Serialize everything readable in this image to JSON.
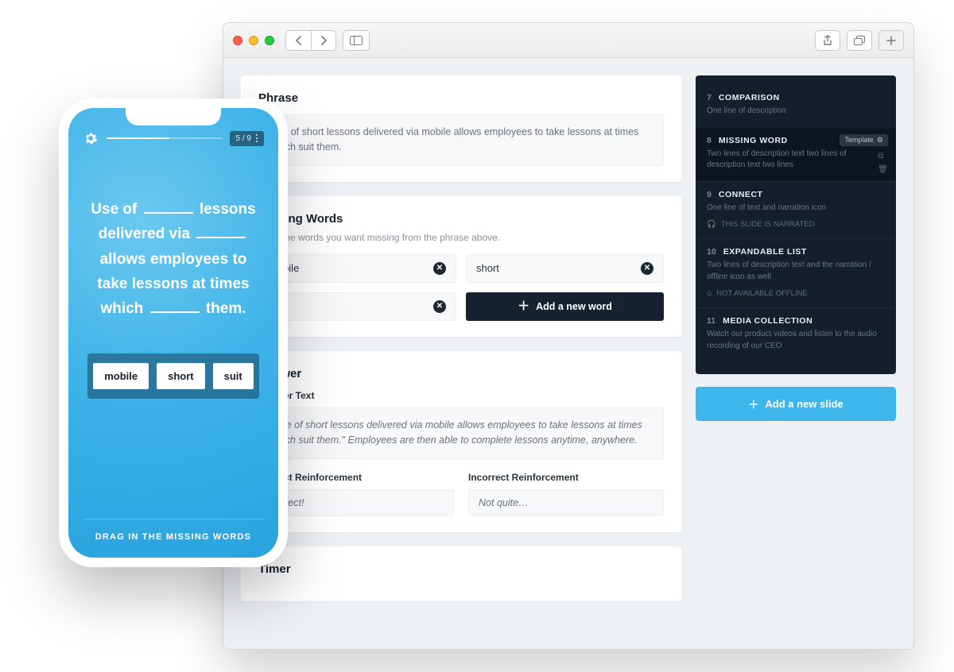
{
  "browser": {
    "buttons": {
      "back": "‹",
      "forward": "›",
      "sidebar": "▥",
      "share": "⇧",
      "tabs": "▣",
      "newtab": "+"
    }
  },
  "editor": {
    "phrase": {
      "title": "Phrase",
      "text": "Use of short lessons delivered via mobile allows employees to take lessons at times which suit them."
    },
    "missing": {
      "title": "Missing Words",
      "hint": "Input the words you want missing from the phrase above.",
      "words": [
        "mobile",
        "short",
        "suit"
      ],
      "add_label": "Add a new word"
    },
    "answer": {
      "title": "Answer",
      "text_label": "Answer Text",
      "text": "\"Use of short lessons delivered via mobile allows employees to take lessons at times which suit them.\" Employees are then able to complete lessons anytime, anywhere.",
      "correct_label": "Correct Reinforcement",
      "correct": "Correct!",
      "incorrect_label": "Incorrect Reinforcement",
      "incorrect": "Not quite…"
    },
    "timer": {
      "title": "Timer"
    }
  },
  "sidebar": {
    "slides": [
      {
        "num": "7",
        "title": "COMPARISON",
        "desc": "One line of description"
      },
      {
        "num": "8",
        "title": "MISSING WORD",
        "desc": "Two lines of description text two lines of description text two lines",
        "badge": "Template"
      },
      {
        "num": "9",
        "title": "CONNECT",
        "desc": "One line of text and narration icon",
        "meta": "THIS SLIDE IS NARRATED",
        "meta_icon": "headphones"
      },
      {
        "num": "10",
        "title": "EXPANDABLE LIST",
        "desc": "Two lines of description text and the narration / offline icon as well",
        "meta": "NOT AVAILABLE OFFLINE",
        "meta_icon": "offline"
      },
      {
        "num": "11",
        "title": "MEDIA COLLECTION",
        "desc": "Watch our product videos and listen to the audio recording of our CEO"
      }
    ],
    "add_slide": "Add a new slide"
  },
  "phone": {
    "counter": "5 / 9",
    "prompt_parts": [
      "Use of ",
      " lessons delivered via ",
      " allows employees to take lessons at times which ",
      " them."
    ],
    "chips": [
      "mobile",
      "short",
      "suit"
    ],
    "footer": "DRAG IN THE MISSING WORDS"
  }
}
